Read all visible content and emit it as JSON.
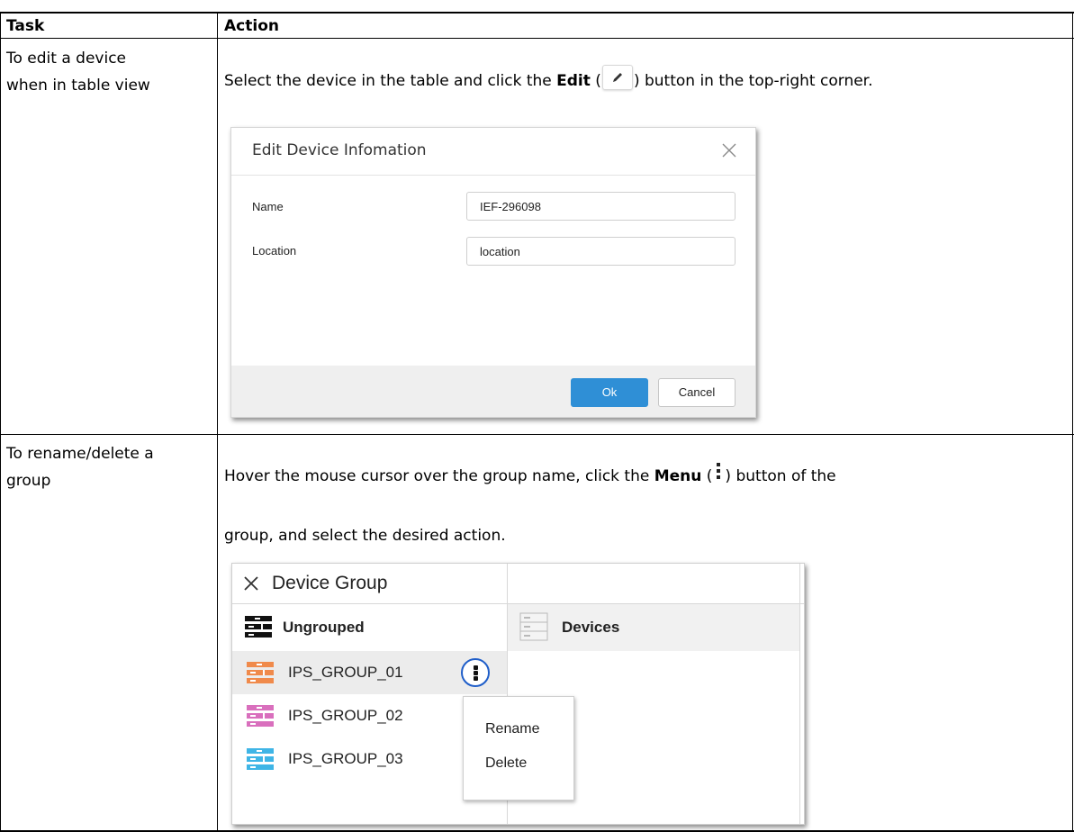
{
  "table": {
    "headers": {
      "task": "Task",
      "action": "Action"
    },
    "rows": [
      {
        "task_line1": "To edit a device",
        "task_line2": "when in table view",
        "action_pre": "Select the device in the table and click the ",
        "action_bold": "Edit",
        "action_post": " button in the top-right corner.",
        "icon": "pencil-icon"
      },
      {
        "task_line1": "To rename/delete a",
        "task_line2": "group",
        "action_pre": "Hover the mouse cursor over the group name, click the ",
        "action_bold": "Menu",
        "action_post": " button of the",
        "action_line2": "group, and select the desired action.",
        "icon": "vertical-dots-icon"
      }
    ]
  },
  "edit_dialog": {
    "title": "Edit Device Infomation",
    "name_label": "Name",
    "name_value": "IEF-296098",
    "location_label": "Location",
    "location_value": "location",
    "ok_label": "Ok",
    "cancel_label": "Cancel",
    "accent": "#2f8fd6"
  },
  "device_group": {
    "title": "Device Group",
    "ungrouped_label": "Ungrouped",
    "devices_label": "Devices",
    "groups": [
      {
        "name": "IPS_GROUP_01",
        "color": "#f08a4b"
      },
      {
        "name": "IPS_GROUP_02",
        "color": "#d96fbd"
      },
      {
        "name": "IPS_GROUP_03",
        "color": "#3fb5e6"
      }
    ],
    "menu": {
      "rename": "Rename",
      "delete": "Delete"
    }
  }
}
